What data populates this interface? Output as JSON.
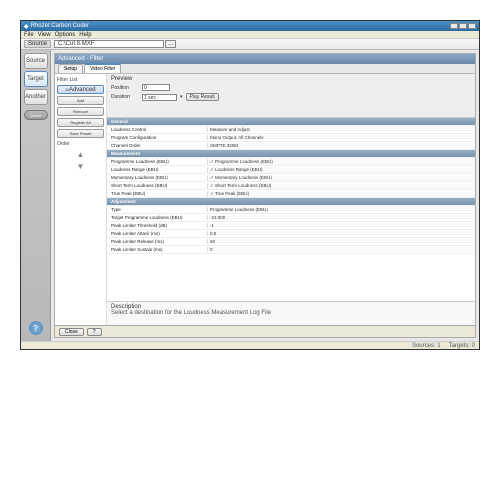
{
  "window": {
    "title": "Rhozet Carbon Coder"
  },
  "menu": [
    "File",
    "View",
    "Options",
    "Help"
  ],
  "toolbar": {
    "source_label": "Source",
    "source_path": "C:\\Cut 8.MXF",
    "browse": "..."
  },
  "sidebar": {
    "items": [
      {
        "label": "Source"
      },
      {
        "label": "Target"
      },
      {
        "label": "Another"
      }
    ],
    "queue": "Queue"
  },
  "panel": {
    "title": "Advanced - Filter",
    "tabs": [
      "Setup",
      "Video Filter"
    ],
    "left": {
      "filter_list": "Filter List",
      "advanced_chk": "Advanced",
      "btns": [
        "Add",
        "Remove",
        "Register All",
        "Save Preset"
      ],
      "order": "Order"
    },
    "preview": {
      "title": "Preview",
      "position_label": "Position",
      "position_value": "0",
      "duration_label": "Duration",
      "duration_value": "1 sec",
      "play_btn": "Play Result"
    },
    "grid": [
      {
        "type": "sect",
        "k": "General",
        "v": ""
      },
      {
        "type": "row",
        "k": "Loudness Control",
        "v": "Measure and Adjust"
      },
      {
        "type": "row",
        "k": "Program Configuration",
        "v": "Mono Output, All Channels"
      },
      {
        "type": "row",
        "k": "Channel Order",
        "v": "SMPTE 320M"
      },
      {
        "type": "sect",
        "k": "Measurement",
        "v": ""
      },
      {
        "type": "row",
        "k": "Programme Loudness (EBU)",
        "v": "✓ Programme Loudness (EBU)"
      },
      {
        "type": "row",
        "k": "Loudness Range (EBU)",
        "v": "✓ Loudness Range (EBU)"
      },
      {
        "type": "row",
        "k": "Momentary Loudness (EBU)",
        "v": "✓ Momentary Loudness (EBU)"
      },
      {
        "type": "row",
        "k": "Short Term Loudness (EBU)",
        "v": "✓ Short Term Loudness (EBU)"
      },
      {
        "type": "row",
        "k": "True Peak (EBU)",
        "v": "✓ True Peak (EBU)"
      },
      {
        "type": "sect",
        "k": "Adjustment",
        "v": ""
      },
      {
        "type": "row",
        "k": "Type",
        "v": "Programme Loudness (EBU)"
      },
      {
        "type": "row",
        "k": "Target Programme Loudness (EBU)",
        "v": "-23.000"
      },
      {
        "type": "row",
        "k": "Peak Limiter Threshold (dB)",
        "v": "-1"
      },
      {
        "type": "row",
        "k": "Peak Limiter Attack (ms)",
        "v": "0.5"
      },
      {
        "type": "row",
        "k": "Peak Limiter Release (ms)",
        "v": "50"
      },
      {
        "type": "row",
        "k": "Peak Limiter Sustain (ms)",
        "v": "0"
      }
    ],
    "description": {
      "title": "Description",
      "text": "Select a destination for the Loudness Measurement Log File"
    }
  },
  "bottom": {
    "close": "Close",
    "help": "?"
  },
  "status": {
    "sources": "Sources: 1",
    "targets": "Targets: 0"
  }
}
